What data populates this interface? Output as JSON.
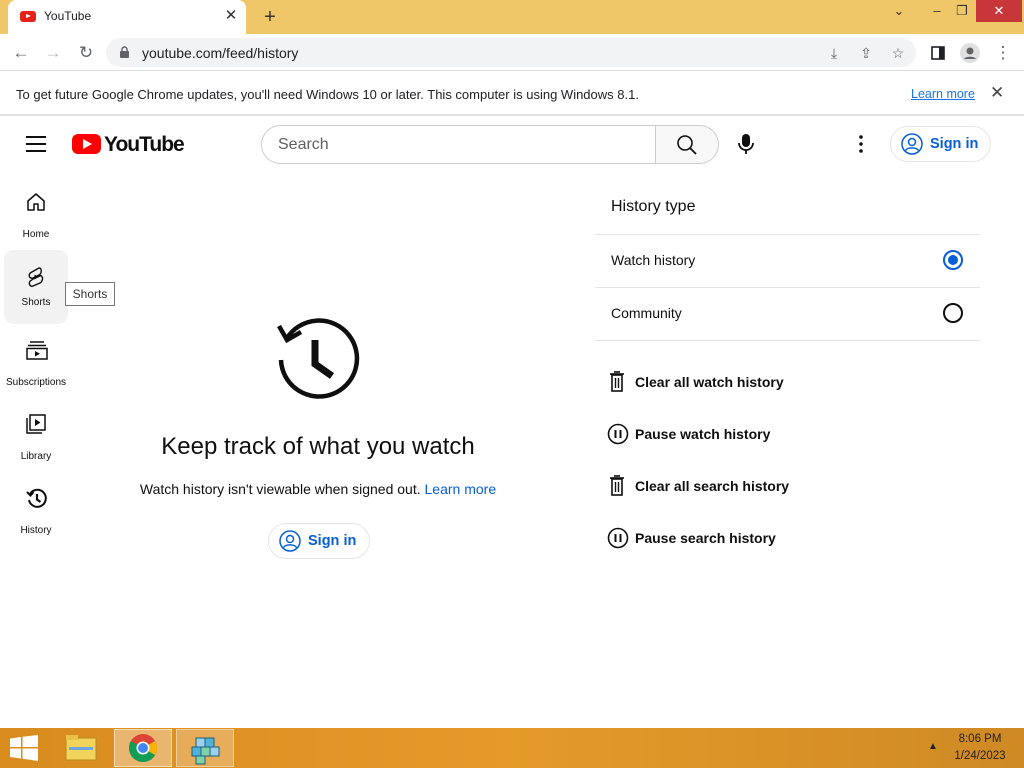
{
  "browser": {
    "tab_title": "YouTube",
    "url": "youtube.com/feed/history",
    "infobar_message": "To get future Google Chrome updates, you'll need Windows 10 or later. This computer is using Windows 8.1.",
    "infobar_link": "Learn more"
  },
  "header": {
    "logo_text": "YouTube",
    "search_placeholder": "Search",
    "signin_label": "Sign in"
  },
  "sidebar": {
    "items": [
      {
        "label": "Home",
        "icon": "home-icon"
      },
      {
        "label": "Shorts",
        "icon": "shorts-icon"
      },
      {
        "label": "Subscriptions",
        "icon": "subscriptions-icon"
      },
      {
        "label": "Library",
        "icon": "library-icon"
      },
      {
        "label": "History",
        "icon": "history-icon"
      }
    ],
    "tooltip": "Shorts"
  },
  "main": {
    "title": "Keep track of what you watch",
    "subtitle": "Watch history isn't viewable when signed out.",
    "subtitle_link": "Learn more",
    "signin_label": "Sign in"
  },
  "panel": {
    "heading": "History type",
    "options": [
      {
        "label": "Watch history",
        "selected": true
      },
      {
        "label": "Community",
        "selected": false
      }
    ],
    "actions": [
      {
        "label": "Clear all watch history",
        "icon": "trash-icon"
      },
      {
        "label": "Pause watch history",
        "icon": "pause-icon"
      },
      {
        "label": "Clear all search history",
        "icon": "trash-icon"
      },
      {
        "label": "Pause search history",
        "icon": "pause-icon"
      }
    ]
  },
  "taskbar": {
    "time": "8:06 PM",
    "date": "1/24/2023"
  },
  "colors": {
    "accent_blue": "#065fd4",
    "youtube_red": "#ff0000",
    "titlebar": "#f0c768"
  }
}
